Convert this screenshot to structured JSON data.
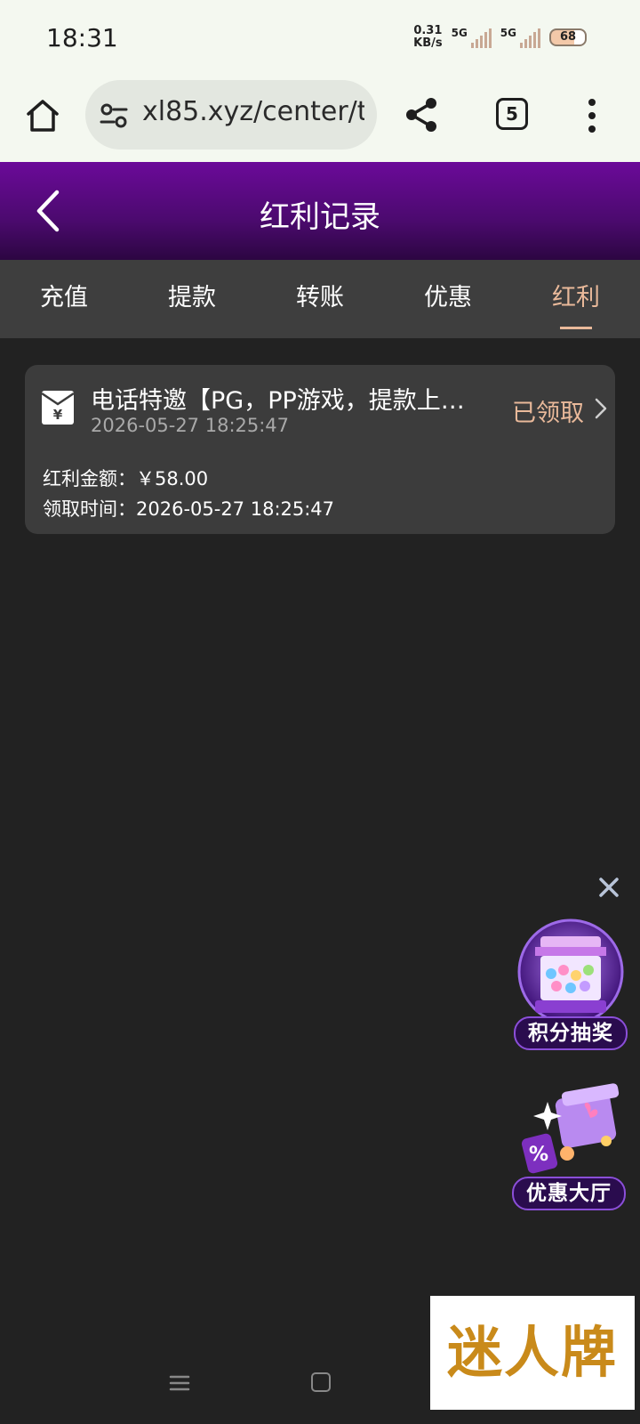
{
  "status_bar": {
    "time": "18:31",
    "net_speed_value": "0.31",
    "net_speed_unit": "KB/s",
    "sim1_label": "5G",
    "sim2_label": "5G",
    "battery": "68"
  },
  "browser": {
    "url": "xl85.xyz/center/t",
    "tab_count": "5",
    "icons": [
      "home-icon",
      "site-settings-icon",
      "share-icon",
      "tabs-counter-icon",
      "more-vert-icon"
    ]
  },
  "header": {
    "title": "红利记录"
  },
  "tabs": [
    {
      "label": "充值",
      "active": false
    },
    {
      "label": "提款",
      "active": false
    },
    {
      "label": "转账",
      "active": false
    },
    {
      "label": "优惠",
      "active": false
    },
    {
      "label": "红利",
      "active": true
    }
  ],
  "records": [
    {
      "title": "电话特邀【PG，PP游戏，提款上…",
      "date": "2026-05-27 18:25:47",
      "status": "已领取",
      "amount_label": "红利金额：",
      "amount": "￥58.00",
      "claim_time_label": "领取时间：",
      "claim_time": "2026-05-27 18:25:47"
    }
  ],
  "floating": {
    "lottery_label": "积分抽奖",
    "promo_hall_label": "优惠大厅"
  },
  "brand": {
    "text": "迷人牌"
  },
  "colors": {
    "accent": "#e9b99a",
    "header_purple": "#6b0a99",
    "page_bg": "#222222",
    "card_bg": "#3c3c3c"
  }
}
